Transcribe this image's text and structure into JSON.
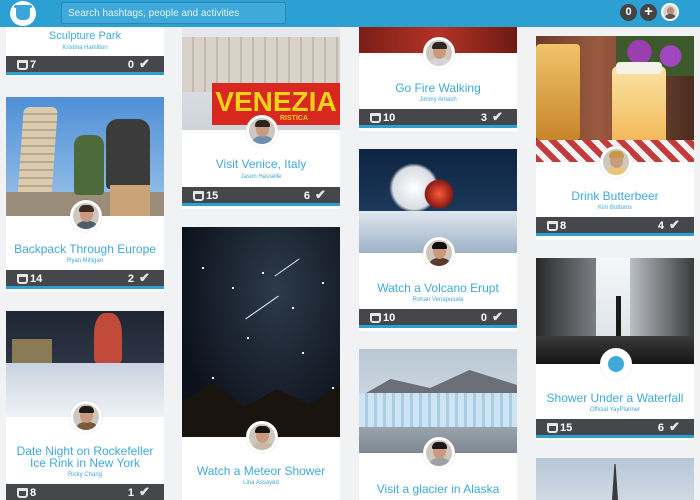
{
  "search": {
    "placeholder": "Search hashtags, people and activities"
  },
  "header": {
    "notification_count": "0",
    "add_label": "+"
  },
  "colors": {
    "accent": "#2c9fd3",
    "link": "#3fa9d9",
    "stats_bar": "#45474b"
  },
  "icons": {
    "logo": "bucket-logo-icon",
    "bucket": "bucket-icon",
    "check": "check-icon"
  },
  "cards": [
    {
      "title": "Sculpture Park",
      "user": "Kristina Hamilton",
      "buckets": "7",
      "done": "0"
    },
    {
      "title": "Backpack Through Europe",
      "user": "Ryan Milligan",
      "buckets": "14",
      "done": "2"
    },
    {
      "title_line1": "Date Night on Rockefeller",
      "title_line2": "Ice Rink in New York",
      "user": "Ricky Chang",
      "buckets": "8",
      "done": "1"
    },
    {
      "title": "Visit Venice, Italy",
      "user": "Jason Hasselle",
      "buckets": "15",
      "done": "6",
      "image_text": "VENEZIA",
      "image_subtext": "RISTICA"
    },
    {
      "title": "Watch a Meteor Shower",
      "user": "Lina Assayed"
    },
    {
      "title": "Go Fire Walking",
      "user": "Jimmy Amash",
      "buckets": "10",
      "done": "3"
    },
    {
      "title": "Watch a Volcano Erupt",
      "user": "Rohan Venapusala",
      "buckets": "10",
      "done": "0"
    },
    {
      "title": "Visit a glacier in Alaska"
    },
    {
      "title": "Drink Butterbeer",
      "user": "Kim Bottoms",
      "buckets": "8",
      "done": "4"
    },
    {
      "title": "Shower Under a Waterfall",
      "user": "Official YayPlanner",
      "buckets": "15",
      "done": "6"
    }
  ]
}
